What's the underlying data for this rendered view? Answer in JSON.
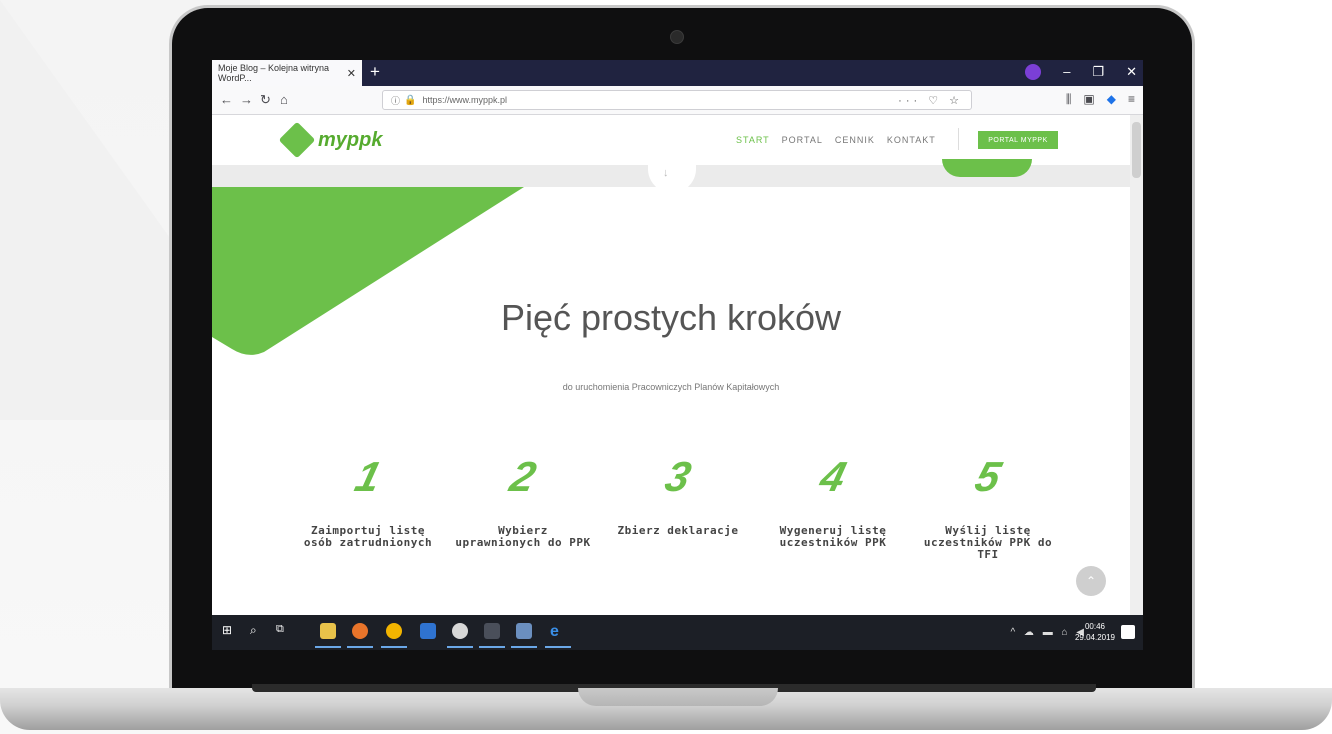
{
  "browser": {
    "tab_title": "Moje Blog – Kolejna witryna WordP...",
    "tab_close": "✕",
    "new_tab": "+",
    "url": "https://www.myppk.pl",
    "window_controls": [
      "–",
      "❐",
      "✕"
    ],
    "toolbar_icons": [
      "back-icon",
      "forward-icon",
      "reload-icon",
      "home-icon",
      "library-icon",
      "sidebar-icon",
      "extension-icon",
      "menu-icon"
    ]
  },
  "site": {
    "logo_text": "myppk",
    "nav": [
      "START",
      "PORTAL",
      "CENNIK",
      "KONTAKT"
    ],
    "cta": "PORTAL MYPPK",
    "brand_color": "#6cc04a"
  },
  "hero": {
    "title": "Pięć prostych kroków",
    "subtitle": "do uruchomienia Pracowniczych Planów Kapitałowych"
  },
  "steps": [
    {
      "number": "1",
      "label": "Zaimportuj listę osób zatrudnionych"
    },
    {
      "number": "2",
      "label": "Wybierz uprawnionych do PPK"
    },
    {
      "number": "3",
      "label": "Zbierz deklaracje"
    },
    {
      "number": "4",
      "label": "Wygeneruj listę uczestników PPK"
    },
    {
      "number": "5",
      "label": "Wyślij listę uczestników PPK do TFI"
    }
  ],
  "taskbar": {
    "time": "00:46",
    "date": "29.04.2019"
  }
}
